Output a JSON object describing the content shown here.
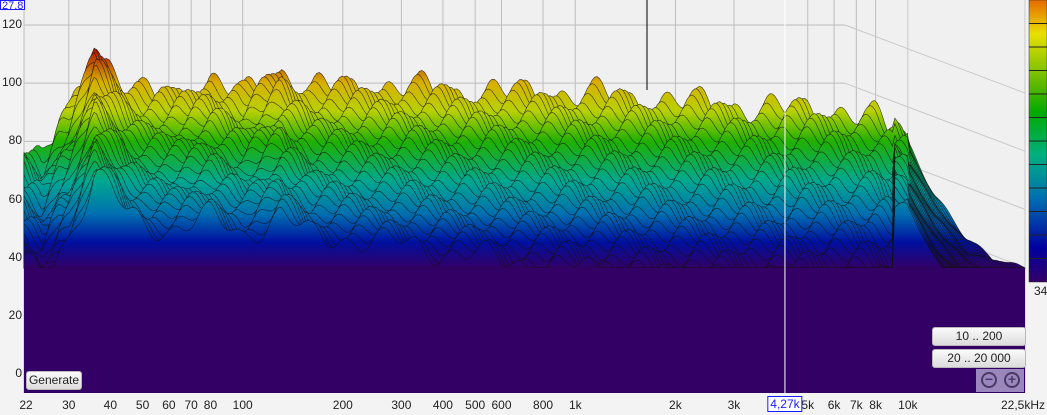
{
  "chart_data": {
    "type": "waterfall",
    "title": "",
    "xlabel": "",
    "ylabel": "",
    "x_scale": "log",
    "xlim": [
      22,
      22500
    ],
    "ylim": [
      0,
      127.8
    ],
    "x_unit": "kHz",
    "x_ticks": [
      "22",
      "30",
      "40",
      "50",
      "60",
      "70",
      "80",
      "100",
      "200",
      "300",
      "400",
      "500",
      "600",
      "800",
      "1k",
      "2k",
      "3k",
      "5k",
      "6k",
      "7k",
      "8k",
      "10k",
      "22,5kHz"
    ],
    "x_tick_values": [
      22,
      30,
      40,
      50,
      60,
      70,
      80,
      100,
      200,
      300,
      400,
      500,
      600,
      800,
      1000,
      2000,
      3000,
      5000,
      6000,
      7000,
      8000,
      10000,
      22500
    ],
    "y_ticks": [
      "120",
      "100",
      "80",
      "60",
      "40",
      "20",
      "0"
    ],
    "y_tick_values": [
      120,
      100,
      80,
      60,
      40,
      20,
      0
    ],
    "y_top_value": "27,8",
    "cursor": {
      "label": "4,27k",
      "frequency": 4270
    },
    "colorbar": {
      "min_label": "34",
      "colors": [
        "#e66a00",
        "#f0a000",
        "#e8e000",
        "#b8d400",
        "#5cb800",
        "#00aa00",
        "#00b080",
        "#00a0a0",
        "#0070b0",
        "#0040b0",
        "#0000a0",
        "#330066"
      ]
    },
    "grid": true,
    "envelope_frequencies": [
      22,
      25,
      28,
      30,
      33,
      36,
      40,
      45,
      50,
      60,
      70,
      80,
      100,
      130,
      160,
      200,
      300,
      400,
      600,
      1000,
      2000,
      3000,
      4000,
      5000,
      6000,
      8000,
      10000,
      12000,
      15000,
      18000,
      22500
    ],
    "envelope_levels_db": [
      78,
      72,
      84,
      88,
      100,
      112,
      106,
      98,
      95,
      95,
      98,
      100,
      95,
      104,
      97,
      98,
      98,
      97,
      96,
      96,
      93,
      92,
      90,
      91,
      90,
      87,
      80,
      62,
      46,
      40,
      37
    ],
    "floor_db": 36
  },
  "controls": {
    "generate_label": "Generate",
    "range_low_label": "10 .. 200",
    "range_full_label": "20 .. 20 000",
    "zoom_out_symbol": "−",
    "zoom_in_symbol": "+"
  }
}
